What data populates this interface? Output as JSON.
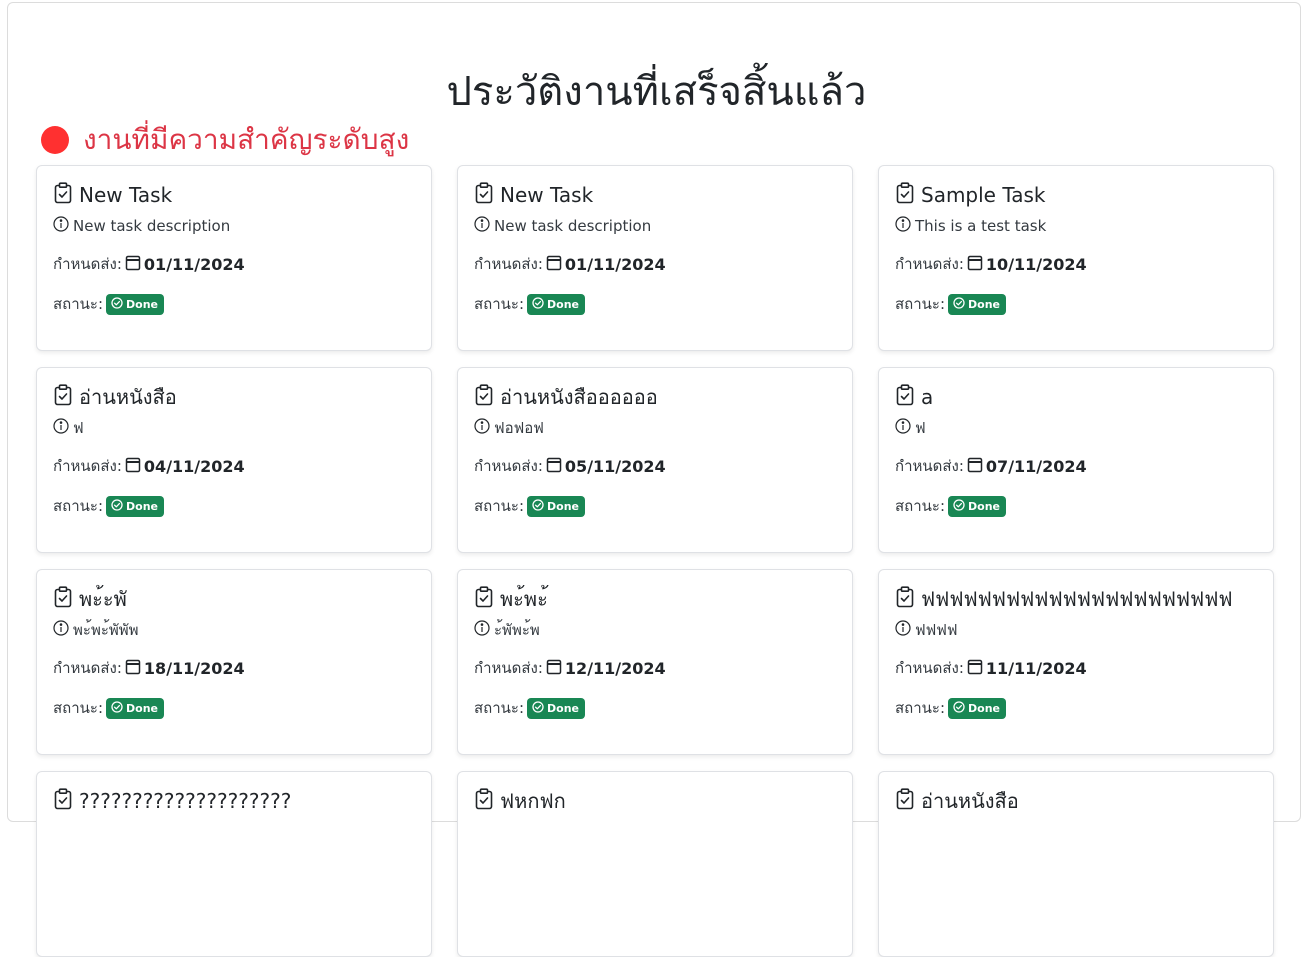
{
  "page": {
    "title": "ประวัติงานที่เสร็จสิ้นแล้ว",
    "section_heading": "งานที่มีความสำคัญระดับสูง",
    "section_dot_color": "#ff3030"
  },
  "labels": {
    "due": "กำหนดส่ง:",
    "status": "สถานะ:"
  },
  "tasks": [
    {
      "title": "New Task",
      "description": "New task description",
      "due": "01/11/2024",
      "status": "Done"
    },
    {
      "title": "New Task",
      "description": "New task description",
      "due": "01/11/2024",
      "status": "Done"
    },
    {
      "title": "Sample Task",
      "description": "This is a test task",
      "due": "10/11/2024",
      "status": "Done"
    },
    {
      "title": "อ่านหนังสือ",
      "description": "ฟ",
      "due": "04/11/2024",
      "status": "Done"
    },
    {
      "title": "อ่านหนังสืออออออ",
      "description": "ฟอฟอฟ",
      "due": "05/11/2024",
      "status": "Done"
    },
    {
      "title": "a",
      "description": "ฟ",
      "due": "07/11/2024",
      "status": "Done"
    },
    {
      "title": "พะ้ะพั",
      "description": "พะ้พะ้พัพัพ",
      "due": "18/11/2024",
      "status": "Done"
    },
    {
      "title": "พะ้พะ้",
      "description": "ะ้พัพะ้พ",
      "due": "12/11/2024",
      "status": "Done"
    },
    {
      "title": "ฟฟฟฟฟฟฟฟฟฟฟฟฟฟฟฟฟฟฟฟฟฟ",
      "description": "ฟฟฟฟ",
      "due": "11/11/2024",
      "status": "Done"
    },
    {
      "title": "????????????????????",
      "description": "",
      "due": "",
      "status": ""
    },
    {
      "title": "ฟหกฟก",
      "description": "",
      "due": "",
      "status": ""
    },
    {
      "title": "อ่านหนังสือ",
      "description": "",
      "due": "",
      "status": ""
    }
  ],
  "colors": {
    "badge_done": "#198754",
    "section_heading": "#dc3545"
  }
}
